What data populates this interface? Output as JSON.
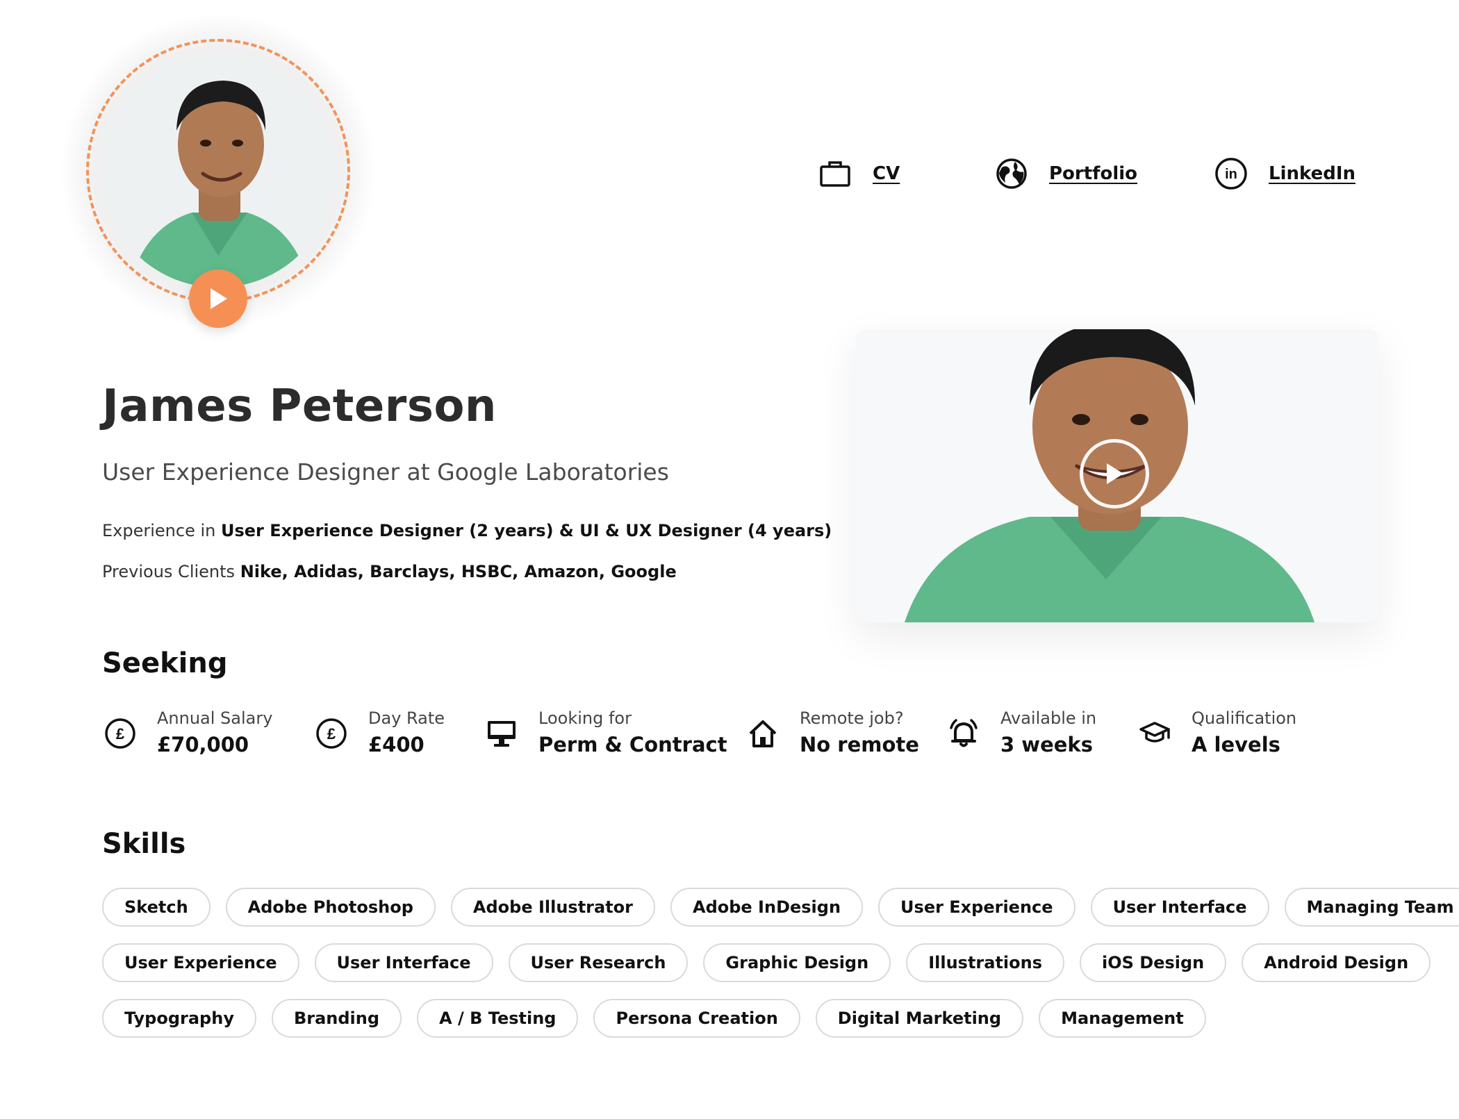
{
  "profile": {
    "name": "James Peterson",
    "title": "User Experience Designer at Google Laboratories",
    "experience_prefix": "Experience in",
    "experience_value": "User Experience Designer (2 years) & UI & UX Designer (4 years)",
    "clients_prefix": "Previous Clients",
    "clients_value": "Nike, Adidas, Barclays, HSBC, Amazon, Google"
  },
  "links": [
    {
      "label": "CV",
      "icon": "briefcase-icon"
    },
    {
      "label": "Portfolio",
      "icon": "globe-icon"
    },
    {
      "label": "LinkedIn",
      "icon": "linkedin-icon"
    }
  ],
  "seeking": {
    "title": "Seeking",
    "items": [
      {
        "label": "Annual Salary",
        "value": "£70,000",
        "icon": "pound-icon"
      },
      {
        "label": "Day Rate",
        "value": "£400",
        "icon": "pound-icon"
      },
      {
        "label": "Looking for",
        "value": "Perm & Contract",
        "icon": "monitor-icon"
      },
      {
        "label": "Remote job?",
        "value": "No remote",
        "icon": "home-icon"
      },
      {
        "label": "Available in",
        "value": "3 weeks",
        "icon": "bell-icon"
      },
      {
        "label": "Qualification",
        "value": "A levels",
        "icon": "graduation-cap-icon"
      }
    ]
  },
  "skills": {
    "title": "Skills",
    "row1": [
      "Sketch",
      "Adobe Photoshop",
      "Adobe Illustrator",
      "Adobe InDesign",
      "User Experience",
      "User Interface",
      "Managing Team"
    ],
    "row2": [
      "User Experience",
      "User Interface",
      "User Research",
      "Graphic Design",
      "Illustrations",
      "iOS Design",
      "Android Design"
    ],
    "row3": [
      "Typography",
      "Branding",
      "A / B Testing",
      "Persona Creation",
      "Digital Marketing",
      "Management"
    ]
  },
  "colors": {
    "accent": "#f58f54",
    "ring": "#f2935a",
    "shirt": "#5fb98a",
    "pill_border": "#dadada"
  }
}
